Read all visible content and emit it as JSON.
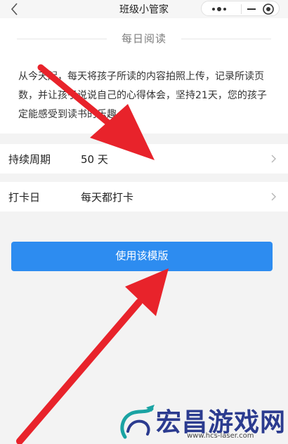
{
  "nav": {
    "title": "班级小管家"
  },
  "section": {
    "title": "每日阅读",
    "description": "从今天起，每天将孩子所读的内容拍照上传，记录所读页数，并让孩子说说自己的心得体会，坚持21天，您的孩子定能感受到读书的乐趣。"
  },
  "settings": [
    {
      "label": "持续周期",
      "value": "50 天"
    },
    {
      "label": "打卡日",
      "value": "每天都打卡"
    }
  ],
  "action": {
    "label": "使用该模版"
  },
  "watermark": {
    "text": "宏昌游戏网",
    "url": "www.hcs-laser.com"
  },
  "colors": {
    "accent": "#2d8cf0",
    "arrow": "#e8232b"
  }
}
